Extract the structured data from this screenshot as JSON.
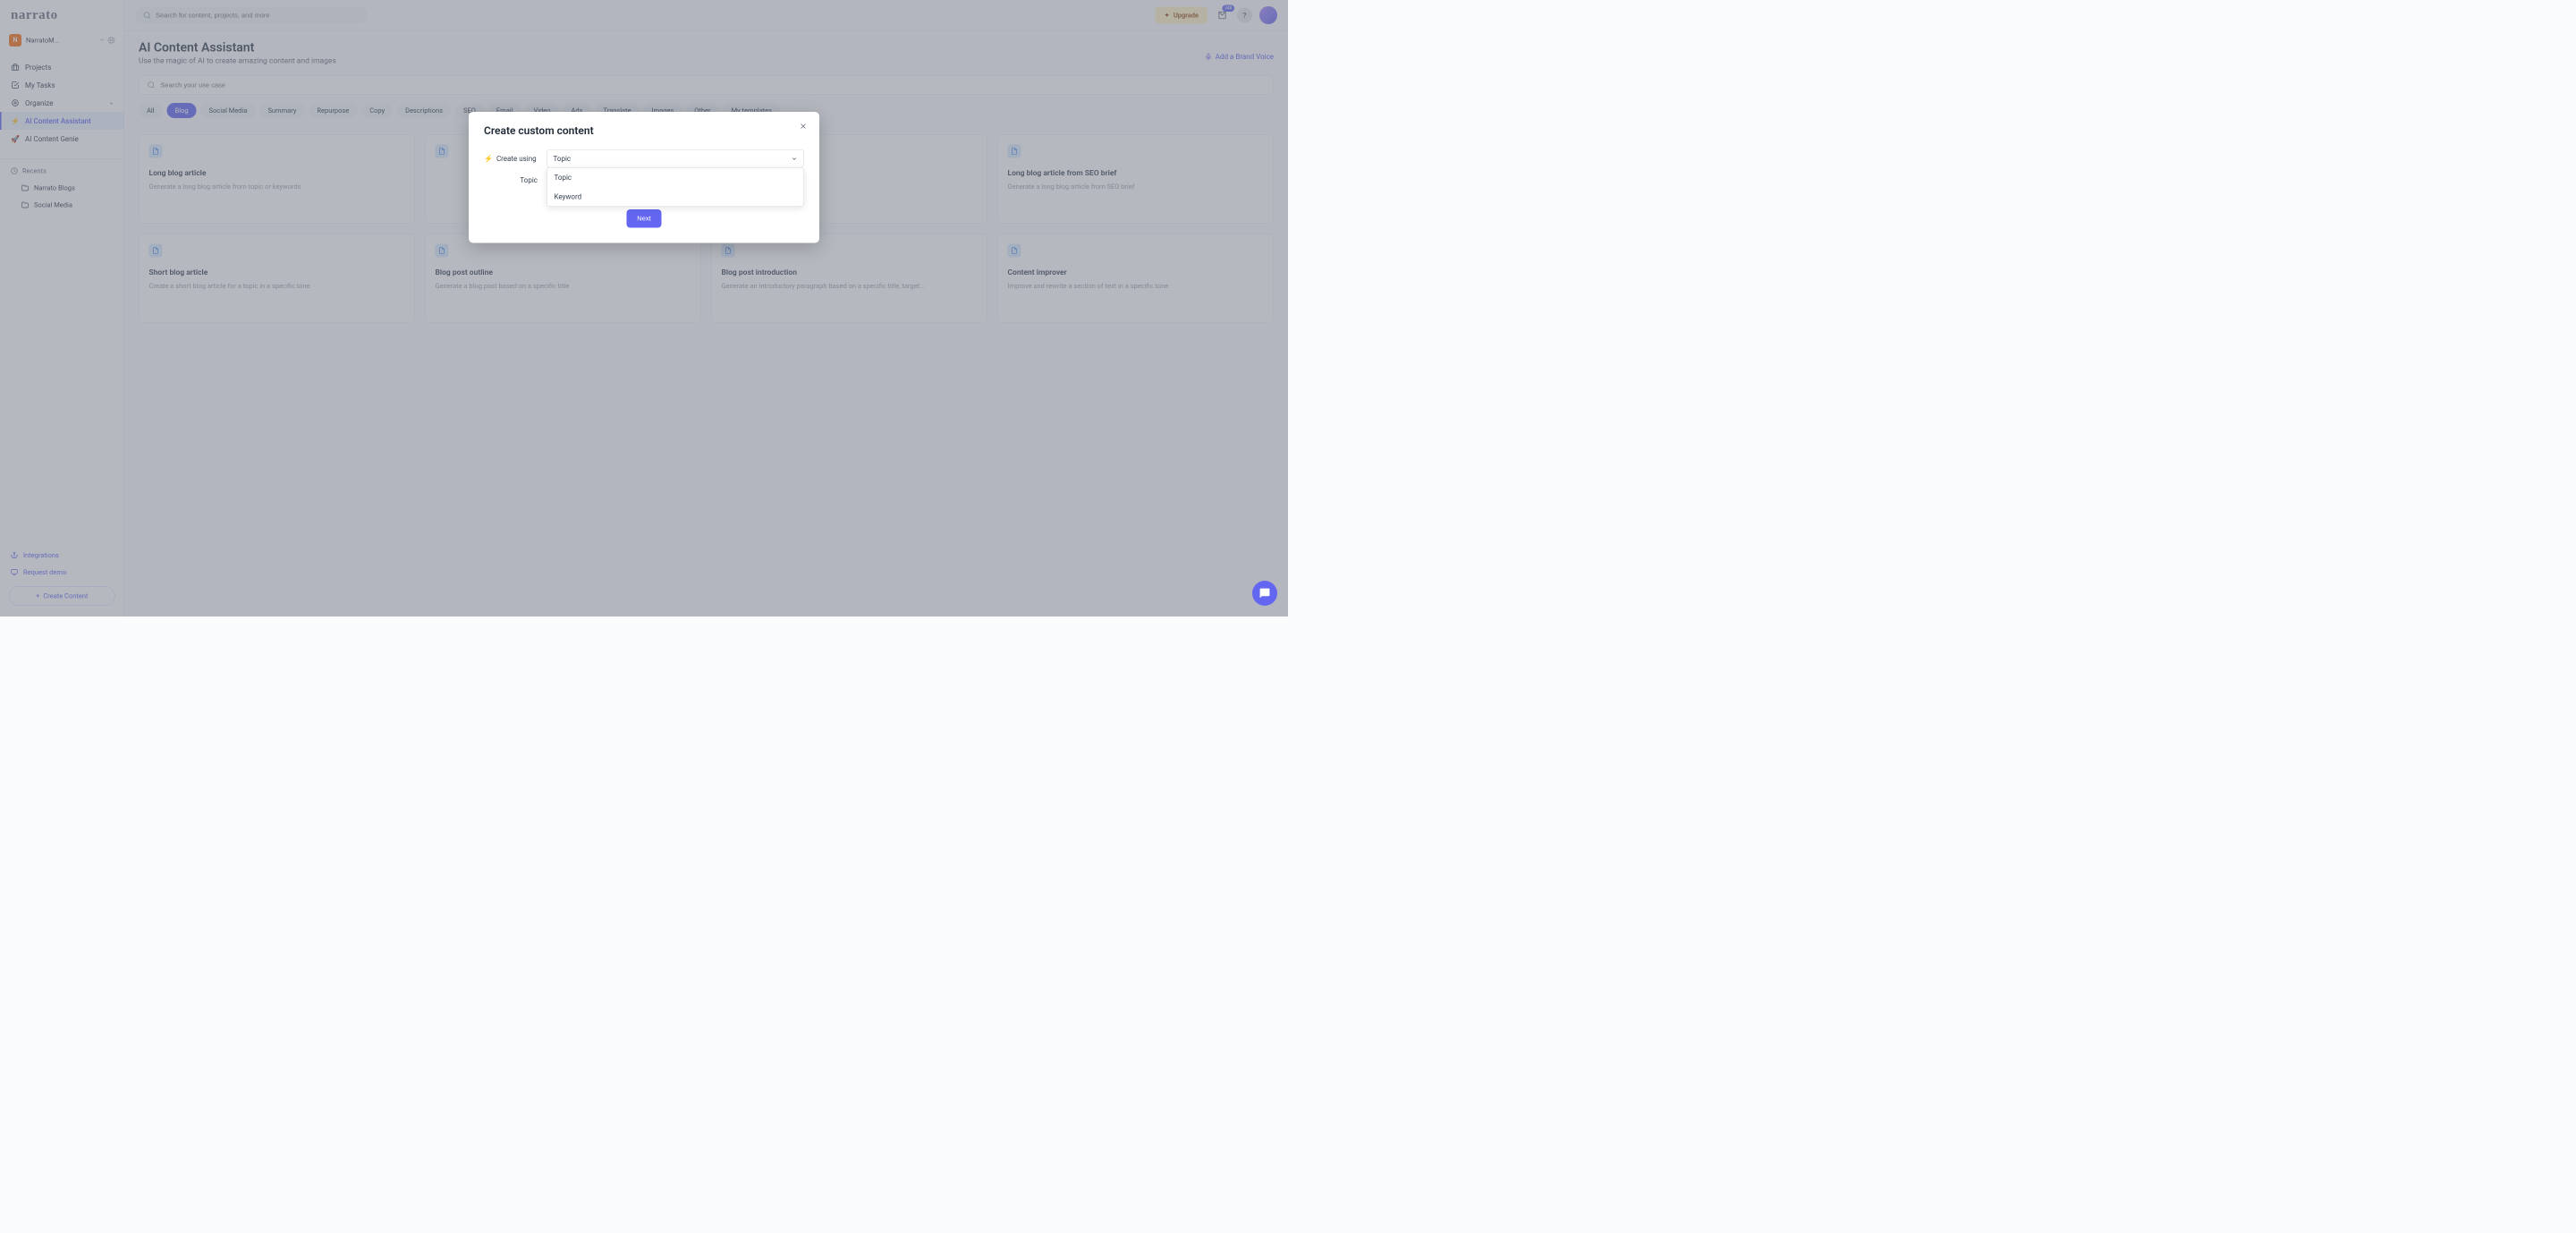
{
  "logo": "narrato",
  "workspace": {
    "initial": "N",
    "name": "NarratoM..."
  },
  "sidebar": {
    "items": [
      {
        "label": "Projects"
      },
      {
        "label": "My Tasks"
      },
      {
        "label": "Organize"
      },
      {
        "label": "AI Content Assistant"
      },
      {
        "label": "AI Content Genie"
      }
    ],
    "recents_label": "Recents",
    "recents": [
      {
        "label": "Narrato Blogs"
      },
      {
        "label": "Social Media"
      }
    ],
    "integrations": "Integrations",
    "request_demo": "Request demo",
    "create_content": "Create Content"
  },
  "topbar": {
    "search_placeholder": "Search for content, projects, and more",
    "upgrade": "Upgrade",
    "notif_count": "348",
    "help": "?"
  },
  "page": {
    "title": "AI Content Assistant",
    "subtitle": "Use the magic of AI to create amazing content and images",
    "brand_voice": "Add a Brand Voice",
    "usecase_placeholder": "Search your use case"
  },
  "chips": [
    "All",
    "Blog",
    "Social Media",
    "Summary",
    "Repurpose",
    "Copy",
    "Descriptions",
    "SEO",
    "Email",
    "Video",
    "Ads",
    "Translate",
    "Images",
    "Other",
    "My templates"
  ],
  "active_chip": "Blog",
  "cards": [
    {
      "title": "Long blog article",
      "desc": "Generate a long blog article from topic or keywords"
    },
    {
      "title": "",
      "desc": ""
    },
    {
      "title": "",
      "desc": ""
    },
    {
      "title": "Long blog article from SEO brief",
      "desc": "Generate a long blog article from SEO brief"
    },
    {
      "title": "Short blog article",
      "desc": "Create a short blog article for a topic in a specific tone"
    },
    {
      "title": "Blog post outline",
      "desc": "Generate a blog post based on a specific title"
    },
    {
      "title": "Blog post introduction",
      "desc": "Generate an introductory paragraph based on a specific title, target..."
    },
    {
      "title": "Content improver",
      "desc": "Improve and rewrite a section of text in a specific tone"
    }
  ],
  "modal": {
    "title": "Create custom content",
    "create_using_label": "Create using",
    "select_value": "Topic",
    "options": [
      "Topic",
      "Keyword"
    ],
    "topic_label": "Topic",
    "next": "Next"
  }
}
